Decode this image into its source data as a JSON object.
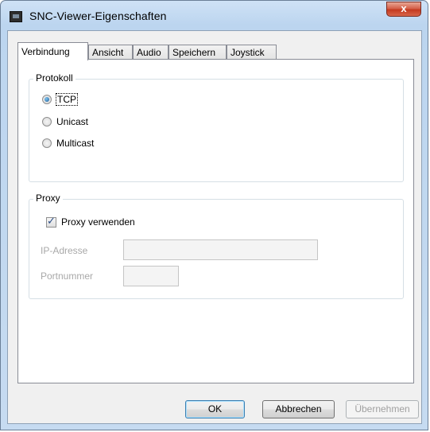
{
  "window": {
    "title": "SNC-Viewer-Eigenschaften",
    "close_glyph": "x"
  },
  "tabs": [
    {
      "label": "Verbindung",
      "active": true
    },
    {
      "label": "Ansicht",
      "active": false
    },
    {
      "label": "Audio",
      "active": false
    },
    {
      "label": "Speichern",
      "active": false
    },
    {
      "label": "Joystick",
      "active": false
    }
  ],
  "protocol": {
    "label": "Protokoll",
    "options": [
      {
        "label": "TCP",
        "checked": true
      },
      {
        "label": "Unicast",
        "checked": false
      },
      {
        "label": "Multicast",
        "checked": false
      }
    ]
  },
  "proxy": {
    "label": "Proxy",
    "use_proxy_label": "Proxy verwenden",
    "use_proxy_checked": true,
    "ip_label": "IP-Adresse",
    "ip_value": "",
    "port_label": "Portnummer",
    "port_value": ""
  },
  "buttons": {
    "ok": "OK",
    "cancel": "Abbrechen",
    "apply": "Übernehmen"
  },
  "colors": {
    "title_bar": "#bcd5ef",
    "close_button": "#c4391f",
    "radio_selected": "#1e5f9a",
    "checkbox_tick": "#2a4d86"
  }
}
